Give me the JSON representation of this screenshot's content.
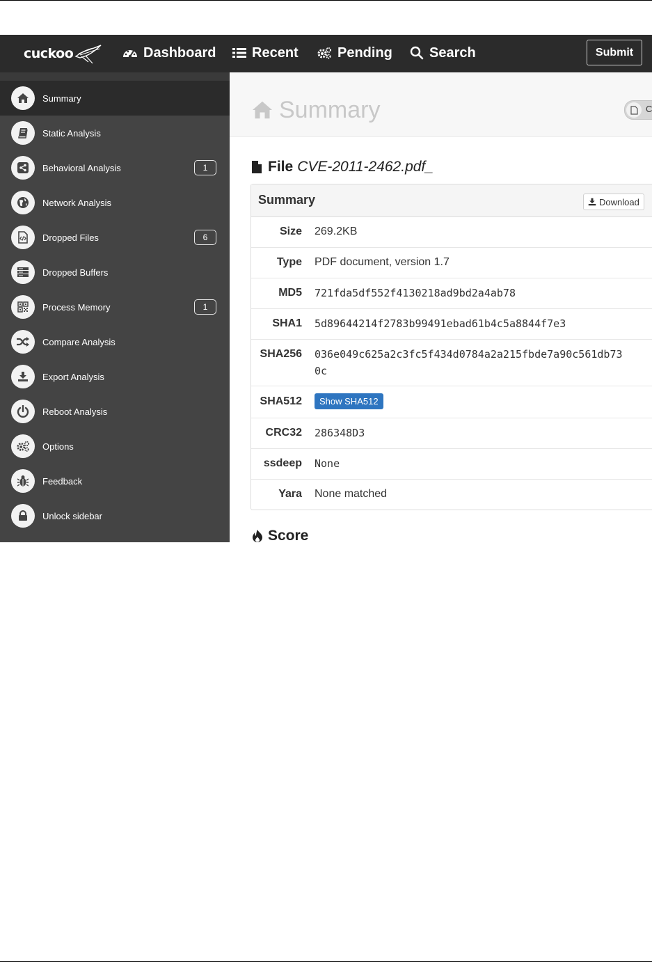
{
  "navbar": {
    "brand": "cuckoo",
    "items": [
      {
        "label": "Dashboard",
        "icon": "dashboard-icon"
      },
      {
        "label": "Recent",
        "icon": "list-icon"
      },
      {
        "label": "Pending",
        "icon": "gears-icon"
      },
      {
        "label": "Search",
        "icon": "search-icon"
      }
    ],
    "submit_label": "Submit"
  },
  "sidebar": {
    "items": [
      {
        "label": "Summary",
        "icon": "home-icon",
        "active": true
      },
      {
        "label": "Static Analysis",
        "icon": "book-icon"
      },
      {
        "label": "Behavioral Analysis",
        "icon": "share-icon",
        "badge": "1"
      },
      {
        "label": "Network Analysis",
        "icon": "globe-icon"
      },
      {
        "label": "Dropped Files",
        "icon": "file-code-icon",
        "badge": "6"
      },
      {
        "label": "Dropped Buffers",
        "icon": "server-icon"
      },
      {
        "label": "Process Memory",
        "icon": "qrcode-icon",
        "badge": "1"
      },
      {
        "label": "Compare Analysis",
        "icon": "shuffle-icon"
      },
      {
        "label": "Export Analysis",
        "icon": "download-icon"
      },
      {
        "label": "Reboot Analysis",
        "icon": "power-icon"
      },
      {
        "label": "Options",
        "icon": "gears-icon"
      },
      {
        "label": "Feedback",
        "icon": "bug-icon"
      },
      {
        "label": "Unlock sidebar",
        "icon": "lock-icon"
      }
    ]
  },
  "main": {
    "page_title": "Summary",
    "header_toggle_text": "C",
    "file_label": "File",
    "file_name": "CVE-2011-2462.pdf_",
    "panel_title": "Summary",
    "download_label": "Download",
    "rows": {
      "size": {
        "key": "Size",
        "value": "269.2KB"
      },
      "type": {
        "key": "Type",
        "value": "PDF document, version 1.7"
      },
      "md5": {
        "key": "MD5",
        "value": "721fda5df552f4130218ad9bd2a4ab78"
      },
      "sha1": {
        "key": "SHA1",
        "value": "5d89644214f2783b99491ebad61b4c5a8844f7e3"
      },
      "sha256": {
        "key": "SHA256",
        "line1": "036e049c625a2c3fc5f434d0784a2a215fbde7a90c561db73",
        "line2": "0c"
      },
      "sha512": {
        "key": "SHA512",
        "button": "Show SHA512"
      },
      "crc32": {
        "key": "CRC32",
        "value": "286348D3"
      },
      "ssdeep": {
        "key": "ssdeep",
        "value": "None"
      },
      "yara": {
        "key": "Yara",
        "value": "None matched"
      }
    },
    "score_label": "Score"
  },
  "colors": {
    "navbar_bg": "#2b2b2b",
    "sidebar_bg": "#444444",
    "sidebar_active_bg": "#2b2b2b",
    "button_blue": "#2e75c0"
  }
}
